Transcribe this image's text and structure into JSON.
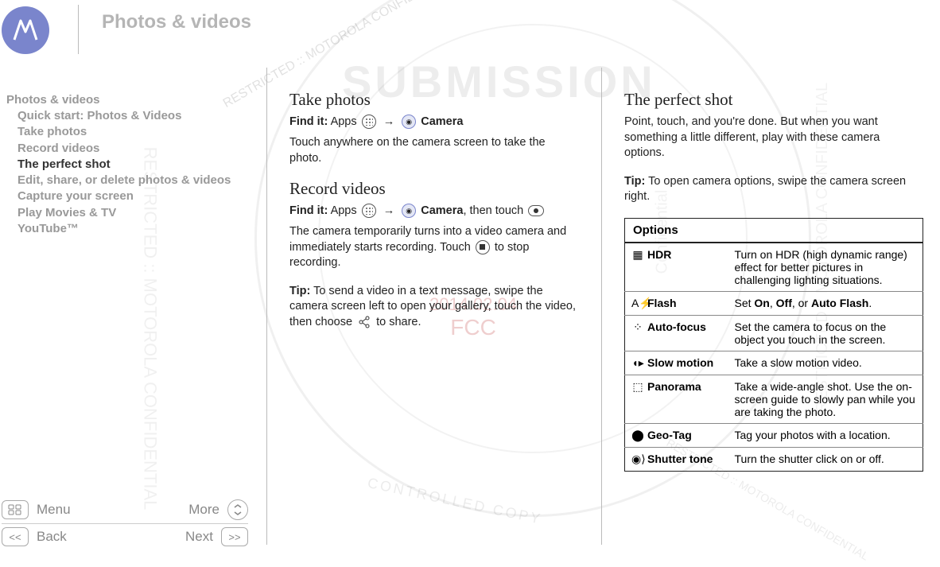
{
  "header": {
    "title": "Photos & videos"
  },
  "sidebar": {
    "root": "Photos & videos",
    "items": [
      {
        "label": "Quick start: Photos & Videos",
        "current": false
      },
      {
        "label": "Take photos",
        "current": false
      },
      {
        "label": "Record videos",
        "current": false
      },
      {
        "label": "The perfect shot",
        "current": true
      },
      {
        "label": "Edit, share, or delete photos & videos",
        "current": false
      },
      {
        "label": "Capture your screen",
        "current": false
      },
      {
        "label": "Play Movies & TV",
        "current": false
      },
      {
        "label": "YouTube™",
        "current": false
      }
    ]
  },
  "footnav": {
    "menu": "Menu",
    "more": "More",
    "back": "Back",
    "next": "Next"
  },
  "col1": {
    "h_take": "Take photos",
    "find_take_pre": "Find it:",
    "find_take_apps": "Apps",
    "find_take_camera": "Camera",
    "para_take": "Touch anywhere on the camera screen to take the photo.",
    "h_record": "Record videos",
    "find_record_pre": "Find it:",
    "find_record_apps": "Apps",
    "find_record_camera": "Camera",
    "find_record_then": ", then touch",
    "para_record": "The camera temporarily turns into a video camera and immediately starts recording. Touch",
    "para_record2": "to stop recording.",
    "tip_label": "Tip:",
    "tip_text": "To send a video in a text message, swipe the camera screen left to open your gallery, touch the video, then choose",
    "tip_text2": "to share."
  },
  "col2": {
    "h_perfect": "The perfect shot",
    "para_perfect": "Point, touch, and you're done. But when you want something a little different, play with these camera options.",
    "tip_label": "Tip:",
    "tip_text": "To open camera options, swipe the camera screen right.",
    "options_header": "Options",
    "options": [
      {
        "icon": "HDR",
        "icon_glyph": "▦",
        "name": "HDR",
        "desc": "Turn on HDR (high dynamic range) effect for better pictures in challenging lighting situations."
      },
      {
        "icon": "flash",
        "icon_glyph": "A⚡",
        "name": "Flash",
        "desc_pre": "Set ",
        "b1": "On",
        "sep1": ", ",
        "b2": "Off",
        "sep2": ", or ",
        "b3": "Auto Flash",
        "desc_post": "."
      },
      {
        "icon": "focus",
        "icon_glyph": "⁘",
        "name": "Auto-focus",
        "desc": "Set the camera to focus on the object you touch in the screen."
      },
      {
        "icon": "slow",
        "icon_glyph": "◖▸",
        "name": "Slow motion",
        "desc": "Take a slow motion video."
      },
      {
        "icon": "pano",
        "icon_glyph": "⬚",
        "name": "Panorama",
        "desc": "Take a wide-angle shot. Use the on-screen guide to slowly pan while you are taking the photo."
      },
      {
        "icon": "geo",
        "icon_glyph": "⬤",
        "name": "Geo-Tag",
        "desc": "Tag your photos with a location."
      },
      {
        "icon": "shutter",
        "icon_glyph": "◉⟩",
        "name": "Shutter tone",
        "desc": "Turn the shutter click on or off."
      }
    ]
  },
  "watermark": {
    "submission": "SUBMISSION",
    "copy": "CONTROLLED COPY",
    "restricted": "RESTRICTED :: MOTOROLA CONFIDENTIAL",
    "date": "2014.02.04",
    "fcc": "FCC",
    "conf": "Confidential"
  }
}
